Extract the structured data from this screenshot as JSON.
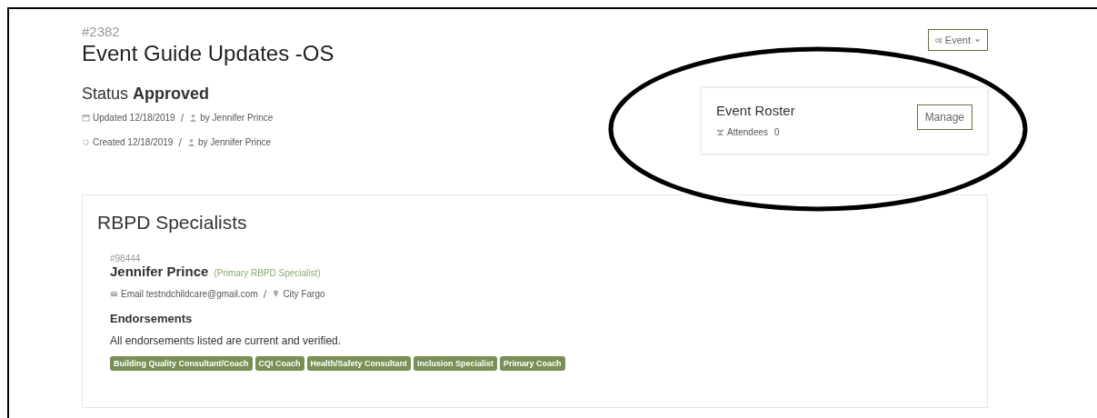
{
  "event": {
    "number": "#2382",
    "title": "Event Guide Updates -OS",
    "status_label": "Status",
    "status": "Approved",
    "updated": {
      "label": "Updated",
      "date": "12/18/2019",
      "separator": "/",
      "by": "by Jennifer Prince"
    },
    "created": {
      "label": "Created",
      "date": "12/18/2019",
      "separator": "/",
      "by": "by Jennifer Prince"
    },
    "menu_button": "Event"
  },
  "roster": {
    "title": "Event Roster",
    "attendees_label": "Attendees",
    "attendees_count": "0",
    "button": "Manage"
  },
  "specialists": {
    "title": "RBPD Specialists",
    "people": [
      {
        "number": "#98444",
        "name": "Jennifer Prince",
        "role": "(Primary RBPD Specialist)",
        "email_label": "Email",
        "email": "testndchildcare@gmail.com",
        "separator": "/",
        "city_label": "City",
        "city": "Fargo",
        "endorsements_title": "Endorsements",
        "endorsements_note": "All endorsements listed are current and verified.",
        "endorsements": [
          "Building Quality Consultant/Coach",
          "CQI Coach",
          "Health/Safety Consultant",
          "Inclusion Specialist",
          "Primary Coach"
        ]
      }
    ]
  }
}
